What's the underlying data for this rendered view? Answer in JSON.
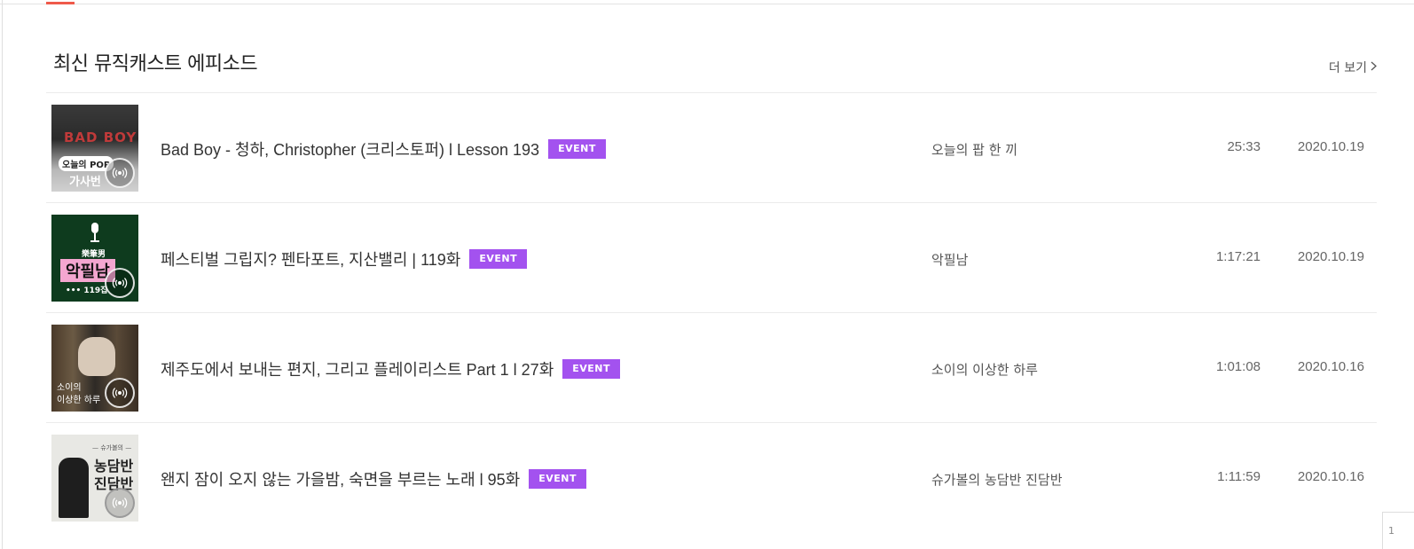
{
  "section": {
    "title": "최신 뮤직캐스트 에피소드",
    "more_label": "더 보기"
  },
  "episodes": [
    {
      "thumb_caption_top": "BAD BOY",
      "thumb_caption_mid": "오늘의 POP",
      "thumb_caption_bottom": "가사번",
      "title": "Bad Boy - 청하, Christopher (크리스토퍼) l Lesson 193",
      "badge": "EVENT",
      "channel": "오늘의 팝 한 끼",
      "duration": "25:33",
      "date": "2020.10.19"
    },
    {
      "thumb_caption_top": "樂筆男",
      "thumb_caption_mid": "악필남",
      "thumb_caption_bottom": "••• 119집",
      "title": "페스티벌 그립지? 펜타포트, 지산밸리 | 119화",
      "badge": "EVENT",
      "channel": "악필남",
      "duration": "1:17:21",
      "date": "2020.10.19"
    },
    {
      "thumb_caption_top": "",
      "thumb_caption_mid": "소이의",
      "thumb_caption_bottom": "이상한 하루",
      "title": "제주도에서 보내는 편지, 그리고 플레이리스트 Part 1 l 27화",
      "badge": "EVENT",
      "channel": "소이의 이상한 하루",
      "duration": "1:01:08",
      "date": "2020.10.16"
    },
    {
      "thumb_caption_top": "— 슈가볼의 —",
      "thumb_caption_mid": "농담반",
      "thumb_caption_bottom": "진담반",
      "title": "왠지 잠이 오지 않는 가을밤, 숙면을 부르는 노래 l 95화",
      "badge": "EVENT",
      "channel": "슈가볼의 농담반 진담반",
      "duration": "1:11:59",
      "date": "2020.10.16"
    }
  ],
  "colors": {
    "badge": "#a352ef",
    "accent": "#ef5a4a"
  },
  "icons": {
    "podcast": "podcast-broadcast-icon",
    "more": "chevron-right-icon"
  },
  "scroll_button_label": "1"
}
